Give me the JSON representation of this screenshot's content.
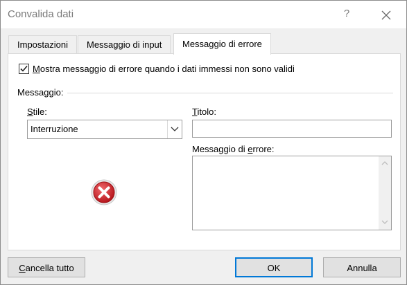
{
  "window": {
    "title": "Convalida dati",
    "help_label": "?"
  },
  "tabs": [
    {
      "label": "Impostazioni"
    },
    {
      "label": "Messaggio di input"
    },
    {
      "label": "Messaggio di errore"
    }
  ],
  "show_error": {
    "checked": true,
    "mnemonic": "M",
    "label_rest": "ostra messaggio di errore quando i dati immessi non sono validi"
  },
  "message_group": {
    "label": "Messaggio:"
  },
  "style_field": {
    "mnemonic": "S",
    "label_rest": "tile:",
    "value": "Interruzione",
    "icon": "error-stop-icon"
  },
  "title_field": {
    "mnemonic": "T",
    "label_rest": "itolo:",
    "value": ""
  },
  "error_message_field": {
    "label_pre": "Messaggio di ",
    "mnemonic": "e",
    "label_post": "rrore:",
    "value": ""
  },
  "buttons": {
    "clear_mnemonic": "C",
    "clear_rest": "ancella tutto",
    "ok": "OK",
    "cancel": "Annulla"
  },
  "colors": {
    "accent": "#0078d7",
    "error_red": "#d6282f"
  }
}
